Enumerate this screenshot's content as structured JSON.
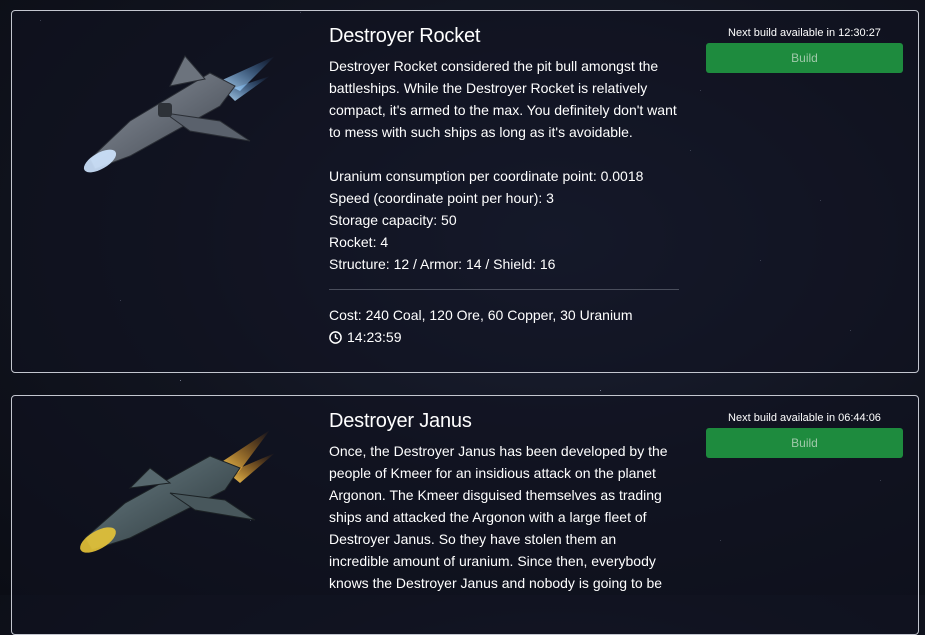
{
  "ships": [
    {
      "name": "Destroyer Rocket",
      "description": "Destroyer Rocket considered the pit bull amongst the battleships. While the Destroyer Rocket is relatively compact, it's armed to the max. You definitely don't want to mess with such ships as long as it's avoidable.",
      "stats": {
        "uranium": "Uranium consumption per coordinate point: 0.0018",
        "speed": "Speed (coordinate point per hour): 3",
        "storage": "Storage capacity: 50",
        "weapon": "Rocket: 4",
        "defense": "Structure: 12 / Armor: 14 / Shield: 16"
      },
      "cost": "Cost: 240 Coal, 120 Ore, 60 Copper, 30 Uranium",
      "build_time": "14:23:59",
      "next_build": "Next build available in 12:30:27",
      "build_label": "Build"
    },
    {
      "name": "Destroyer Janus",
      "description": "Once, the Destroyer Janus has been developed by the people of Kmeer for an insidious attack on the planet Argonon. The Kmeer disguised themselves as trading ships and attacked the Argonon with a large fleet of Destroyer Janus. So they have stolen them an incredible amount of uranium. Since then, everybody knows the Destroyer Janus and nobody is going to be",
      "next_build": "Next build available in 06:44:06",
      "build_label": "Build"
    }
  ],
  "icons": {
    "clock": "clock-icon"
  },
  "colors": {
    "build_button": "#1e8b3e",
    "card_border": "#c3c6cf"
  }
}
